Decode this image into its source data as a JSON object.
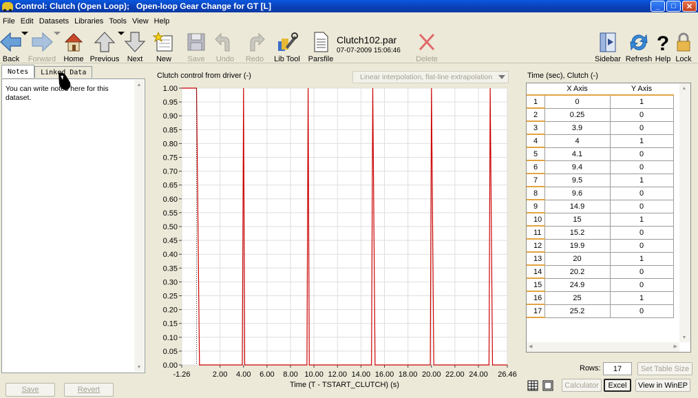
{
  "window": {
    "title": "Control: Clutch (Open Loop);   Open-loop Gear Change for GT [L]",
    "controls": {
      "minimize": "_",
      "maximize": "□",
      "close": "✕"
    }
  },
  "menu": [
    "File",
    "Edit",
    "Datasets",
    "Libraries",
    "Tools",
    "View",
    "Help"
  ],
  "toolbar": {
    "back": "Back",
    "forward": "Forward",
    "home": "Home",
    "previous": "Previous",
    "next": "Next",
    "new": "New",
    "save": "Save",
    "undo": "Undo",
    "redo": "Redo",
    "libtool": "Lib Tool",
    "parsfile": "Parsfile",
    "file_name": "Clutch102.par",
    "file_date": "07-07-2009 15:06:46",
    "delete": "Delete",
    "sidebar": "Sidebar",
    "refresh": "Refresh",
    "help": "Help",
    "lock": "Lock"
  },
  "left": {
    "tabs": [
      "Notes",
      "Linked Data"
    ],
    "notes_text": "You can write notes here for this dataset.",
    "save": "Save",
    "revert": "Revert"
  },
  "center": {
    "title": "Clutch control from driver (-)",
    "interpolation": "Linear interpolation, flat-line extrapolation"
  },
  "chart_data": {
    "type": "line",
    "title": "Clutch control from driver (-)",
    "xlabel": "Time (T - TSTART_CLUTCH) (s)",
    "ylabel": "",
    "xlim": [
      -1.26,
      26.46
    ],
    "ylim": [
      0,
      1
    ],
    "x_ticks": [
      "-1.26",
      "2.00",
      "4.00",
      "6.00",
      "8.00",
      "10.00",
      "12.00",
      "14.00",
      "16.00",
      "18.00",
      "20.00",
      "22.00",
      "24.00",
      "26.46"
    ],
    "x_tick_values": [
      -1.26,
      2,
      4,
      6,
      8,
      10,
      12,
      14,
      16,
      18,
      20,
      22,
      24,
      26.46
    ],
    "y_ticks": [
      "0.00",
      "0.05",
      "0.10",
      "0.15",
      "0.20",
      "0.25",
      "0.30",
      "0.35",
      "0.40",
      "0.45",
      "0.50",
      "0.55",
      "0.60",
      "0.65",
      "0.70",
      "0.75",
      "0.80",
      "0.85",
      "0.90",
      "0.95",
      "1.00"
    ],
    "y_tick_values": [
      0,
      0.05,
      0.1,
      0.15,
      0.2,
      0.25,
      0.3,
      0.35,
      0.4,
      0.45,
      0.5,
      0.55,
      0.6,
      0.65,
      0.7,
      0.75,
      0.8,
      0.85,
      0.9,
      0.95,
      1
    ],
    "grid": true,
    "color": "#cc0000",
    "x": [
      -1.26,
      0,
      0.25,
      3.9,
      4,
      4.1,
      9.4,
      9.5,
      9.6,
      14.9,
      15,
      15.2,
      19.9,
      20,
      20.2,
      24.9,
      25,
      25.2,
      26.46
    ],
    "y": [
      1,
      1,
      0,
      0,
      1,
      0,
      0,
      1,
      0,
      0,
      1,
      0,
      0,
      1,
      0,
      0,
      1,
      0,
      0
    ]
  },
  "right": {
    "title": "Time (sec), Clutch (-)",
    "col_x": "X Axis",
    "col_y": "Y Axis",
    "rows": [
      [
        "1",
        "0",
        "1"
      ],
      [
        "2",
        "0.25",
        "0"
      ],
      [
        "3",
        "3.9",
        "0"
      ],
      [
        "4",
        "4",
        "1"
      ],
      [
        "5",
        "4.1",
        "0"
      ],
      [
        "6",
        "9.4",
        "0"
      ],
      [
        "7",
        "9.5",
        "1"
      ],
      [
        "8",
        "9.6",
        "0"
      ],
      [
        "9",
        "14.9",
        "0"
      ],
      [
        "10",
        "15",
        "1"
      ],
      [
        "11",
        "15.2",
        "0"
      ],
      [
        "12",
        "19.9",
        "0"
      ],
      [
        "13",
        "20",
        "1"
      ],
      [
        "14",
        "20.2",
        "0"
      ],
      [
        "15",
        "24.9",
        "0"
      ],
      [
        "16",
        "25",
        "1"
      ],
      [
        "17",
        "25.2",
        "0"
      ]
    ],
    "rows_label": "Rows:",
    "rows_value": "17",
    "set_table_size": "Set Table Size",
    "calculator": "Calculator",
    "excel": "Excel",
    "view_winep": "View in WinEP"
  }
}
